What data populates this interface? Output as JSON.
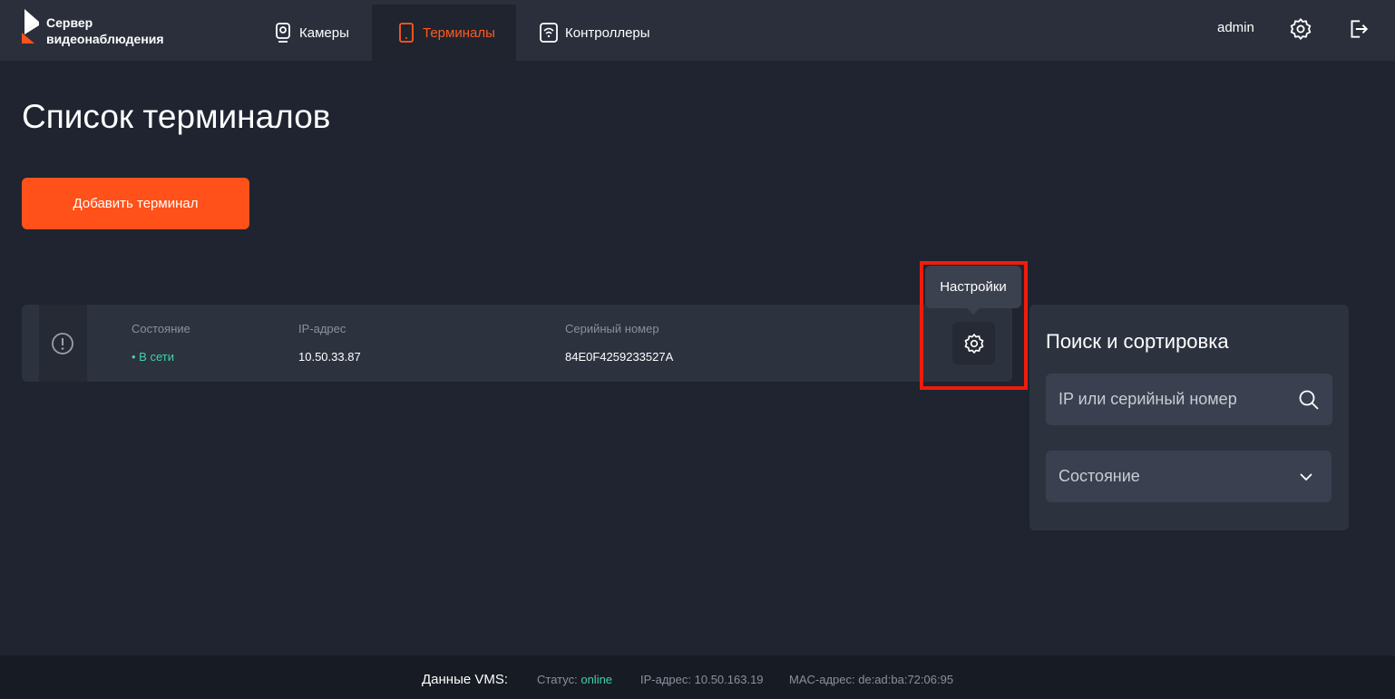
{
  "header": {
    "logo_line1": "Сервер",
    "logo_line2": "видеонаблюдения",
    "nav": [
      {
        "label": "Камеры",
        "icon": "camera-icon"
      },
      {
        "label": "Терминалы",
        "icon": "tablet-icon",
        "active": true
      },
      {
        "label": "Контроллеры",
        "icon": "wifi-controller-icon"
      }
    ],
    "user": "admin",
    "settings_icon": "gear-icon",
    "logout_icon": "logout-icon"
  },
  "main": {
    "title": "Список терминалов",
    "add_button": "Добавить терминал"
  },
  "terminal": {
    "status_label": "Состояние",
    "status_value": "• В сети",
    "ip_label": "IP-адрес",
    "ip_value": "10.50.33.87",
    "serial_label": "Серийный номер",
    "serial_value": "84E0F4259233527A",
    "tooltip": "Настройки"
  },
  "sidebar": {
    "title": "Поиск и сортировка",
    "search_placeholder": "IP или серийный номер",
    "select_label": "Состояние"
  },
  "footer": {
    "title": "Данные VMS:",
    "status_label": "Статус:",
    "status_value": "online",
    "ip_label": "IP-адрес:",
    "ip_value": "10.50.163.19",
    "mac_label": "MAC-адрес:",
    "mac_value": "de:ad:ba:72:06:95"
  },
  "colors": {
    "accent": "#ff5119",
    "online": "#3fd3a7",
    "highlight": "#ee1c0d"
  }
}
